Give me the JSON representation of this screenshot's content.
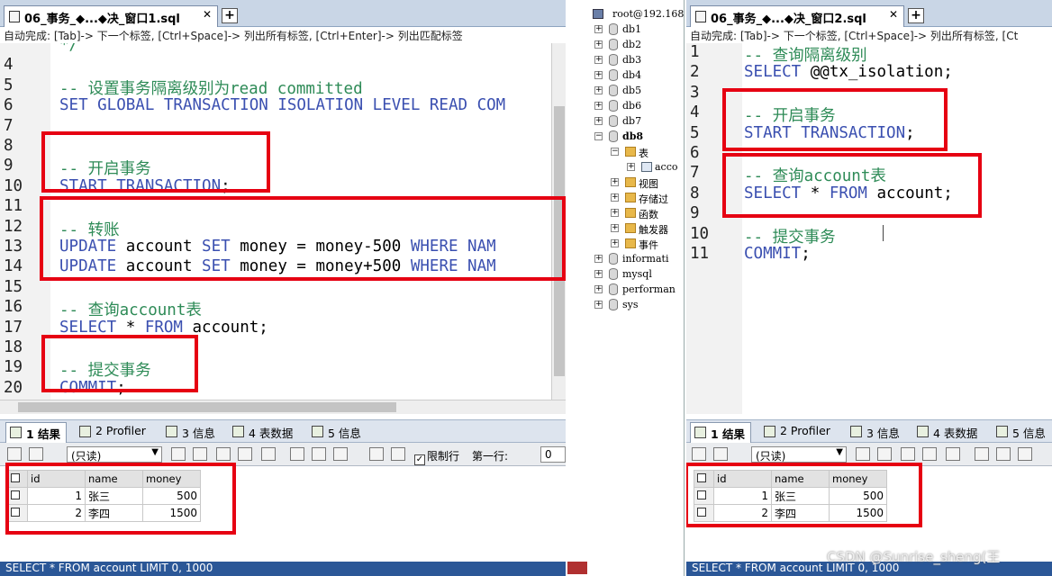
{
  "left": {
    "tab_title": "06_事务_◆...◆决_窗口1.sql",
    "new_tab": "+",
    "hint": "自动完成: [Tab]-> 下一个标签, [Ctrl+Space]-> 列出所有标签, [Ctrl+Enter]-> 列出匹配标签",
    "lines": [
      {
        "n": "",
        "html": "<span class='cmt'>*/</span>",
        "fold": "└"
      },
      {
        "n": "4",
        "html": ""
      },
      {
        "n": "5",
        "html": "<span class='cmt'>-- 设置事务隔离级别为read committed</span>"
      },
      {
        "n": "6",
        "html": "<span class='kw'>SET GLOBAL TRANSACTION ISOLATION LEVEL READ COM</span>"
      },
      {
        "n": "7",
        "html": ""
      },
      {
        "n": "8",
        "html": ""
      },
      {
        "n": "9",
        "html": "<span class='cmt'>-- 开启事务</span>"
      },
      {
        "n": "10",
        "html": "<span class='kw'>START TRANSACTION</span>;"
      },
      {
        "n": "11",
        "html": ""
      },
      {
        "n": "12",
        "html": "<span class='cmt'>-- 转账</span>"
      },
      {
        "n": "13",
        "html": "<span class='kw'>UPDATE</span> account <span class='kw'>SET</span> money = money-500 <span class='kw'>WHERE NAM</span>"
      },
      {
        "n": "14",
        "html": "<span class='kw'>UPDATE</span> account <span class='kw'>SET</span> money = money+500 <span class='kw'>WHERE NAM</span>"
      },
      {
        "n": "15",
        "html": ""
      },
      {
        "n": "16",
        "html": "<span class='cmt'>-- 查询account表</span>"
      },
      {
        "n": "17",
        "html": "<span class='kw'>SELECT</span> * <span class='kw'>FROM</span> account;"
      },
      {
        "n": "18",
        "html": ""
      },
      {
        "n": "19",
        "html": "<span class='cmt'>-- 提交事务</span>"
      },
      {
        "n": "20",
        "html": "<span class='kw'>COMMIT</span>;"
      }
    ],
    "result_tabs": [
      "1 结果",
      "2 Profiler",
      "3 信息",
      "4 表数据",
      "5 信息"
    ],
    "readonly_combo": "(只读)",
    "limit_label": "限制行",
    "first_row_label": "第一行:",
    "first_row_value": "0",
    "columns": [
      "id",
      "name",
      "money"
    ],
    "rows": [
      [
        "1",
        "张三",
        "500"
      ],
      [
        "2",
        "李四",
        "1500"
      ]
    ],
    "status": "SELECT * FROM account LIMIT 0, 1000"
  },
  "tree": {
    "root": "root@192.168",
    "dbs": [
      "db1",
      "db2",
      "db3",
      "db4",
      "db5",
      "db6",
      "db7",
      "db8"
    ],
    "db8_children": [
      "表",
      "acco",
      "视图",
      "存储过",
      "函数",
      "触发器",
      "事件"
    ],
    "others": [
      "informati",
      "mysql",
      "performan",
      "sys"
    ]
  },
  "right": {
    "tab_title": "06_事务_◆...◆决_窗口2.sql",
    "new_tab": "+",
    "hint": "自动完成: [Tab]-> 下一个标签, [Ctrl+Space]-> 列出所有标签, [Ct",
    "lines": [
      {
        "n": "1",
        "html": "<span class='cmt'>-- 查询隔离级别</span>"
      },
      {
        "n": "2",
        "html": "<span class='kw'>SELECT</span> @@tx_isolation;"
      },
      {
        "n": "3",
        "html": ""
      },
      {
        "n": "4",
        "html": "<span class='cmt'>-- 开启事务</span>"
      },
      {
        "n": "5",
        "html": "<span class='kw'>START TRANSACTION</span>;"
      },
      {
        "n": "6",
        "html": ""
      },
      {
        "n": "7",
        "html": "<span class='cmt'>-- 查询account表</span>"
      },
      {
        "n": "8",
        "html": "<span class='kw'>SELECT</span> * <span class='kw'>FROM</span> account;"
      },
      {
        "n": "9",
        "html": ""
      },
      {
        "n": "10",
        "html": "<span class='cmt'>-- 提交事务</span>"
      },
      {
        "n": "11",
        "html": "<span class='kw'>COMMIT</span>;"
      }
    ],
    "result_tabs": [
      "1 结果",
      "2 Profiler",
      "3 信息",
      "4 表数据",
      "5 信息"
    ],
    "readonly_combo": "(只读)",
    "columns": [
      "id",
      "name",
      "money"
    ],
    "rows": [
      [
        "1",
        "张三",
        "500"
      ],
      [
        "2",
        "李四",
        "1500"
      ]
    ],
    "status": "SELECT * FROM account LIMIT 0, 1000"
  },
  "watermark": "CSDN @Sunrise_sheng(王",
  "colors": {
    "highlight": "#e60012",
    "comment": "#2e8b57",
    "keyword": "#3a4fb0",
    "status": "#2b5797"
  }
}
